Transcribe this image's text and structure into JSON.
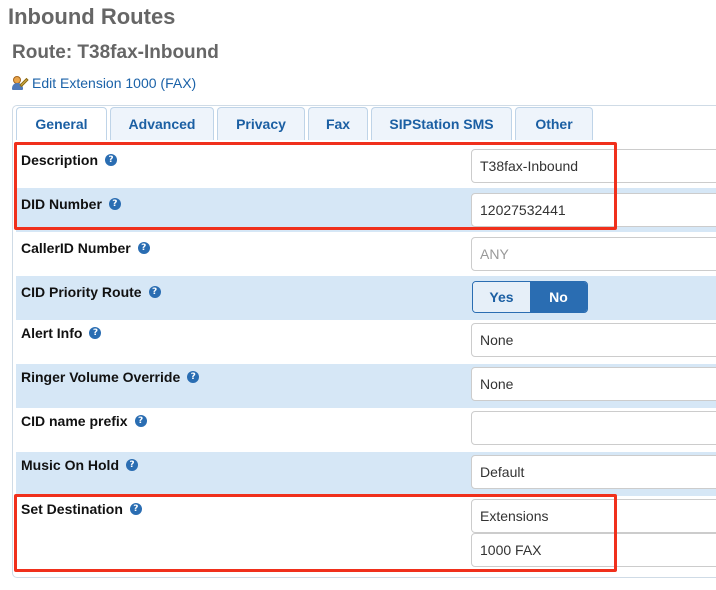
{
  "page": {
    "title": "Inbound Routes",
    "route_title": "Route: T38fax-Inbound",
    "edit_link": "Edit Extension 1000 (FAX)"
  },
  "tabs": [
    {
      "label": "General",
      "active": true
    },
    {
      "label": "Advanced"
    },
    {
      "label": "Privacy"
    },
    {
      "label": "Fax"
    },
    {
      "label": "SIPStation SMS"
    },
    {
      "label": "Other"
    }
  ],
  "help_glyph": "?",
  "form": {
    "description": {
      "label": "Description",
      "value": "T38fax-Inbound"
    },
    "did_number": {
      "label": "DID Number",
      "value": "12027532441"
    },
    "callerid_number": {
      "label": "CallerID Number",
      "placeholder": "ANY"
    },
    "cid_priority_route": {
      "label": "CID Priority Route",
      "yes": "Yes",
      "no": "No",
      "selected": "No"
    },
    "alert_info": {
      "label": "Alert Info",
      "value": "None"
    },
    "ringer_volume_override": {
      "label": "Ringer Volume Override",
      "value": "None"
    },
    "cid_name_prefix": {
      "label": "CID name prefix",
      "value": ""
    },
    "music_on_hold": {
      "label": "Music On Hold",
      "value": "Default"
    },
    "set_destination": {
      "label": "Set Destination",
      "module": "Extensions",
      "target": "1000 FAX"
    }
  },
  "colors": {
    "highlight": "#f0301c",
    "accent": "#2a6db2",
    "row_shade": "#d6e7f6"
  },
  "icons": [
    "edit-user-icon",
    "help-icon"
  ]
}
